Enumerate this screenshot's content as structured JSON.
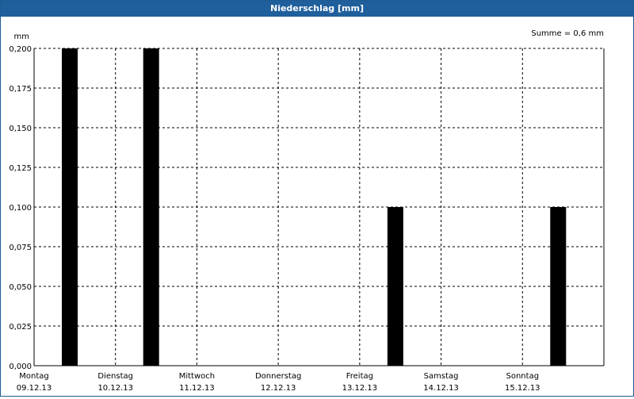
{
  "window": {
    "title": "Niederschlag [mm]"
  },
  "summary": "Summe = 0,6 mm",
  "chart_data": {
    "type": "bar",
    "ylabel": "mm",
    "ylim": [
      0,
      0.2
    ],
    "grid": true,
    "yticks": [
      "0,000",
      "0,025",
      "0,050",
      "0,075",
      "0,100",
      "0,125",
      "0,150",
      "0,175",
      "0,200"
    ],
    "categories": [
      {
        "day": "Montag",
        "date": "09.12.13"
      },
      {
        "day": "Dienstag",
        "date": "10.12.13"
      },
      {
        "day": "Mittwoch",
        "date": "11.12.13"
      },
      {
        "day": "Donnerstag",
        "date": "12.12.13"
      },
      {
        "day": "Freitag",
        "date": "13.12.13"
      },
      {
        "day": "Samstag",
        "date": "14.12.13"
      },
      {
        "day": "Sonntag",
        "date": "15.12.13"
      }
    ],
    "bars": [
      {
        "label": "Montag 09.12.13",
        "value": 0.2
      },
      {
        "label": "Dienstag 10.12.13",
        "value": 0.2
      },
      {
        "label": "Freitag 13.12.13",
        "value": 0.1
      },
      {
        "label": "Sonntag 15.12.13",
        "value": 0.1
      }
    ],
    "colors": {
      "bar": "#000000",
      "grid": "#000000",
      "titlebar": "#1f5f9c"
    }
  }
}
